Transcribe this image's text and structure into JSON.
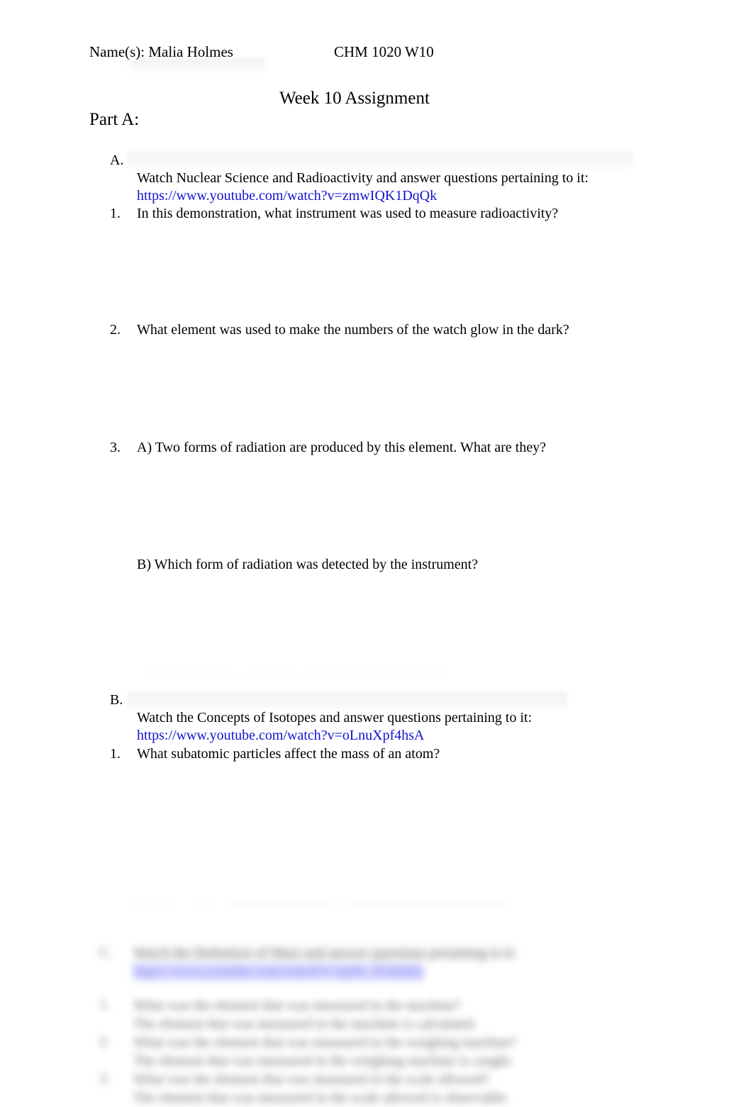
{
  "document": {
    "name_field": "Name(s): Malia Holmes",
    "course_code": "CHM 1020 W10",
    "title": "Week 10 Assignment",
    "part_label": "Part A:"
  },
  "colors": {
    "link": "#1111cf",
    "text": "#000000",
    "page_background": "#ffffff",
    "highlight_shade": "rgba(0,0,0,0.045)"
  },
  "sections": [
    {
      "marker": "A.",
      "text": "Watch Nuclear Science and Radioactivity and answer questions pertaining to it:",
      "url": "https://www.youtube.com/watch?v=zmwIQK1DqQk"
    },
    {
      "marker": "B.",
      "text": "Watch the Concepts of Isotopes and answer questions pertaining to it:",
      "url": "https://www.youtube.com/watch?v=oLnuXpf4hsA"
    }
  ],
  "questions": [
    {
      "marker": "1.",
      "text": "In this demonstration, what instrument was used to measure radioactivity?"
    },
    {
      "marker": "2.",
      "text": "What element was used to make the numbers of the watch glow in the dark?"
    },
    {
      "marker": "3.",
      "text": "A) Two forms of radiation are produced by this element. What are they?"
    },
    {
      "marker": "",
      "text": "B) Which form of radiation was detected by the instrument?"
    },
    {
      "marker": "1.",
      "text": "What subatomic particles affect the mass of an atom?"
    }
  ],
  "blurred_footer": {
    "note": "illegible blurred continuation of the document",
    "lines": [
      "Watch the Definition of Mass and answer questions pertaining to it:",
      "https://www.youtube.com/watch?v=jqNc_IGKkhQ",
      "What was the element that was measured in the machine?",
      "The element that was measured in the machine is calculated.",
      "What was the element that was measured in the weighing machine?",
      "The element that was measured in the weighing machine is caught.",
      "What was the element that was measured in the scale allowed?",
      "The element that was measured in the scale allowed is observable."
    ]
  }
}
